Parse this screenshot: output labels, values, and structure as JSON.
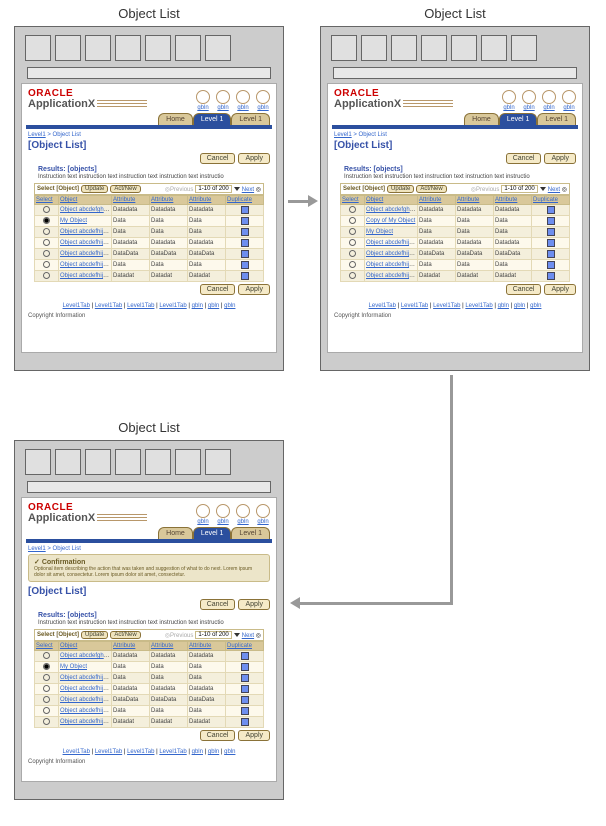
{
  "labels": {
    "panel1": "Object List",
    "panel2": "Object List",
    "panel3": "Object List"
  },
  "common": {
    "oracle": "ORACLE",
    "appname": "ApplicationX",
    "globalLink": "gbln",
    "tabs": {
      "home": "Home",
      "level1": "Level 1"
    },
    "breadcrumb": {
      "link": "Level1",
      "current": "Object List"
    },
    "pageTitle": "[Object List]",
    "cancel": "Cancel",
    "apply": "Apply",
    "results": "Results: [objects]",
    "instruction": "Instruction text instruction text instruction text instruction text instructio",
    "select": "Select [Object]",
    "update": "Update",
    "actnew": "Act/New",
    "prev": "Previous",
    "page": "1-10 of 200",
    "next": "Next",
    "cols": {
      "select": "Select",
      "object": "Object",
      "attr": "Attribute",
      "dup": "Duplicate"
    },
    "foot": {
      "tab": "Level1Tab",
      "g": "gbln"
    },
    "copyright": "Copyright Information"
  },
  "panel1rows": [
    {
      "sel": false,
      "obj": "Object abcdefghijklm…",
      "a1": "Datadata",
      "a2": "Datadata",
      "a3": "Datadata"
    },
    {
      "sel": true,
      "obj": "My Object",
      "a1": "Data",
      "a2": "Data",
      "a3": "Data"
    },
    {
      "sel": false,
      "obj": "Object abcdefhijklm…",
      "a1": "Data",
      "a2": "Data",
      "a3": "Data"
    },
    {
      "sel": false,
      "obj": "Object abcdefhijklm…",
      "a1": "Datadata",
      "a2": "Datadata",
      "a3": "Datadata"
    },
    {
      "sel": false,
      "obj": "Object abcdefhijklm…",
      "a1": "DataData",
      "a2": "DataData",
      "a3": "DataData"
    },
    {
      "sel": false,
      "obj": "Object abcdefhijk…",
      "a1": "Data",
      "a2": "Data",
      "a3": "Data"
    },
    {
      "sel": false,
      "obj": "Object abcdefhijklm…",
      "a1": "Datadat",
      "a2": "Datadat",
      "a3": "Datadat"
    }
  ],
  "panel2rows": [
    {
      "sel": false,
      "obj": "Object abcdefghijklm…",
      "a1": "Datadata",
      "a2": "Datadata",
      "a3": "Datadata"
    },
    {
      "sel": false,
      "obj": "Copy of My Object",
      "a1": "Data",
      "a2": "Data",
      "a3": "Data"
    },
    {
      "sel": false,
      "obj": "My Object",
      "a1": "Data",
      "a2": "Data",
      "a3": "Data"
    },
    {
      "sel": false,
      "obj": "Object abcdefhijk…",
      "a1": "Datadata",
      "a2": "Datadata",
      "a3": "Datadata"
    },
    {
      "sel": false,
      "obj": "Object abcdefhijklm…",
      "a1": "DataData",
      "a2": "DataData",
      "a3": "DataData"
    },
    {
      "sel": false,
      "obj": "Object abcdefhijklm…",
      "a1": "Data",
      "a2": "Data",
      "a3": "Data"
    },
    {
      "sel": false,
      "obj": "Object abcdefhijklm…",
      "a1": "Datadat",
      "a2": "Datadat",
      "a3": "Datadat"
    }
  ],
  "panel3": {
    "confTitle": "Confirmation",
    "confText": "Optional item describing the action that was taken and suggestion of what to do next. Lorem ipsum dolor sit amet, consectetur. Lorem ipsum dolor sit amet, consectetur."
  },
  "panel3rows": [
    {
      "sel": false,
      "obj": "Object abcdefghijklm…",
      "a1": "Datadata",
      "a2": "Datadata",
      "a3": "Datadata"
    },
    {
      "sel": true,
      "obj": "My Object",
      "a1": "Data",
      "a2": "Data",
      "a3": "Data"
    },
    {
      "sel": false,
      "obj": "Object abcdefhijklm…",
      "a1": "Data",
      "a2": "Data",
      "a3": "Data"
    },
    {
      "sel": false,
      "obj": "Object abcdefhijklm…",
      "a1": "Datadata",
      "a2": "Datadata",
      "a3": "Datadata"
    },
    {
      "sel": false,
      "obj": "Object abcdefhijk…",
      "a1": "DataData",
      "a2": "DataData",
      "a3": "DataData"
    },
    {
      "sel": false,
      "obj": "Object abcdefhijklm…",
      "a1": "Data",
      "a2": "Data",
      "a3": "Data"
    },
    {
      "sel": false,
      "obj": "Object abcdefhijklm…",
      "a1": "Datadat",
      "a2": "Datadat",
      "a3": "Datadat"
    }
  ]
}
